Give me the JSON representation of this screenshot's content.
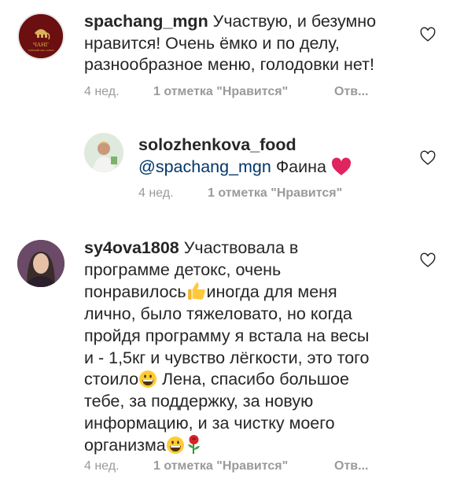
{
  "comments": [
    {
      "username": "spachang_mgn",
      "lines": [
        " Участвую, и безумно",
        "нравится! Очень ёмко и по делу,",
        "разнообразное меню, голодовки нет!"
      ],
      "time": "4 нед.",
      "likes": "1 отметка \"Нравится\"",
      "reply": "Отв...",
      "avatar": {
        "logo_text": "ЧАНГ",
        "subtext": "ТАЙСКИЙ SPA САЛОН",
        "bg": "#6b0f10",
        "accent": "#d9b25a"
      }
    },
    {
      "username": "solozhenkova_food",
      "mention": "@spachang_mgn",
      "text": " Фаина",
      "emoji": "red-heart",
      "time": "4 нед.",
      "likes": "1 отметка \"Нравится\""
    },
    {
      "username": "sy4ova1808",
      "lines": [
        " Участвовала в",
        "программе детокс, очень",
        "понравилось",
        "иногда для меня",
        "лично, было тяжеловато, но когда",
        "пройдя программу я встала на весы",
        "и - 1,5кг и чувство лёгкости, это того",
        "стоило",
        " Лена, спасибо большое",
        "тебе, за поддержку, за новую",
        "информацию, и за чистку моего",
        "организма"
      ],
      "emojis": [
        "thumbs-up",
        "grinning-face",
        "grinning-face",
        "rose"
      ],
      "time": "4 нед.",
      "likes": "1 отметка \"Нравится\"",
      "reply": "Отв..."
    }
  ],
  "colors": {
    "text": "#262626",
    "meta": "#9a9a9a",
    "mention": "#00376b",
    "heart": "#e0245e"
  }
}
